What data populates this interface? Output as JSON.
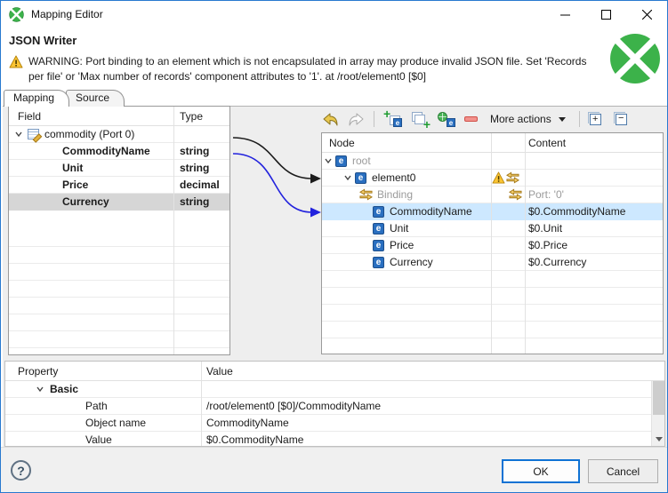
{
  "window": {
    "title": "Mapping Editor"
  },
  "header": {
    "title": "JSON Writer",
    "warning_text": "WARNING: Port binding to an element which is not encapsulated in array may produce invalid JSON file. Set 'Records per file' or 'Max number of records' component attributes to '1'. at /root/element0 [$0]"
  },
  "tabs": {
    "mapping": "Mapping",
    "source": "Source"
  },
  "fields": {
    "col_field": "Field",
    "col_type": "Type",
    "port_row": "commodity (Port 0)",
    "rows": [
      {
        "name": "CommodityName",
        "type": "string"
      },
      {
        "name": "Unit",
        "type": "string"
      },
      {
        "name": "Price",
        "type": "decimal"
      },
      {
        "name": "Currency",
        "type": "string",
        "selected": true
      }
    ]
  },
  "toolbar": {
    "more_actions": "More actions"
  },
  "nodes": {
    "col_node": "Node",
    "col_content": "Content",
    "root": "root",
    "element0": "element0",
    "binding_label": "Binding",
    "binding_content": "Port: '0'",
    "rows": [
      {
        "name": "CommodityName",
        "content": "$0.CommodityName",
        "selected": true
      },
      {
        "name": "Unit",
        "content": "$0.Unit"
      },
      {
        "name": "Price",
        "content": "$0.Price"
      },
      {
        "name": "Currency",
        "content": "$0.Currency"
      }
    ]
  },
  "properties": {
    "col_property": "Property",
    "col_value": "Value",
    "group": "Basic",
    "rows": [
      {
        "name": "Path",
        "value": "/root/element0 [$0]/CommodityName"
      },
      {
        "name": "Object name",
        "value": "CommodityName"
      },
      {
        "name": "Value",
        "value": "$0.CommodityName"
      }
    ]
  },
  "footer": {
    "ok": "OK",
    "cancel": "Cancel"
  },
  "colors": {
    "accent_green": "#3cb24a",
    "selection_blue": "#cde8ff",
    "selection_gray": "#d6d6d6",
    "warning_gold": "#f5bc22",
    "binding_gold": "#c8921a",
    "element_blue": "#2a6fc0",
    "window_border": "#2879cf"
  }
}
